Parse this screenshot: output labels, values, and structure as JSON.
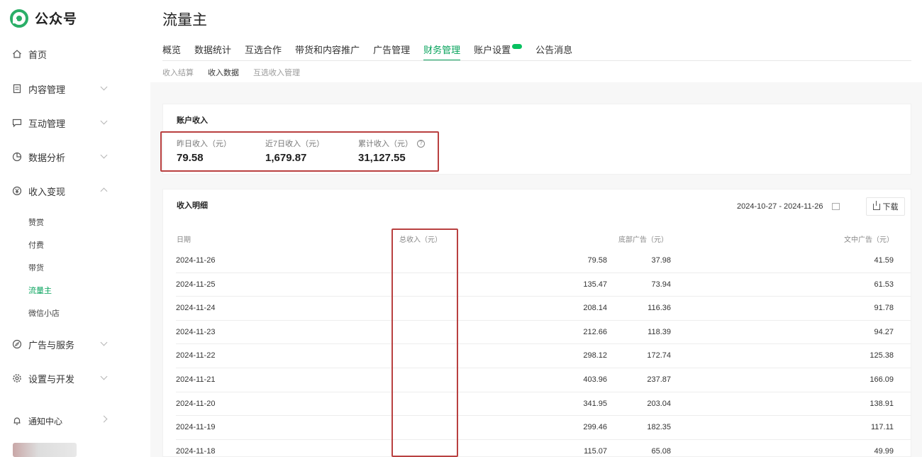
{
  "app": {
    "name": "公众号"
  },
  "sidebar": {
    "items": [
      {
        "label": "首页"
      },
      {
        "label": "内容管理"
      },
      {
        "label": "互动管理"
      },
      {
        "label": "数据分析"
      },
      {
        "label": "收入变现"
      },
      {
        "label": "广告与服务"
      },
      {
        "label": "设置与开发"
      },
      {
        "label": "通知中心"
      }
    ],
    "monetize_sub": [
      {
        "label": "赞赏"
      },
      {
        "label": "付费"
      },
      {
        "label": "带货"
      },
      {
        "label": "流量主"
      },
      {
        "label": "微信小店"
      }
    ]
  },
  "page": {
    "title": "流量主"
  },
  "tabs": [
    {
      "label": "概览"
    },
    {
      "label": "数据统计"
    },
    {
      "label": "互选合作"
    },
    {
      "label": "带货和内容推广"
    },
    {
      "label": "广告管理"
    },
    {
      "label": "财务管理"
    },
    {
      "label": "账户设置"
    },
    {
      "label": "公告消息"
    }
  ],
  "subtabs": [
    {
      "label": "收入结算"
    },
    {
      "label": "收入数据"
    },
    {
      "label": "互选收入管理"
    }
  ],
  "account_income": {
    "title": "账户收入",
    "yesterday": {
      "label": "昨日收入（元）",
      "value": "79.58"
    },
    "last7": {
      "label": "近7日收入（元）",
      "value": "1,679.87"
    },
    "total": {
      "label": "累计收入（元）",
      "value": "31,127.55"
    }
  },
  "income_detail": {
    "title": "收入明细",
    "date_range": "2024-10-27 - 2024-11-26",
    "download_label": "下载",
    "columns": [
      "日期",
      "总收入（元）",
      "底部广告（元）",
      "文中广告（元）"
    ],
    "rows": [
      {
        "date": "2024-11-26",
        "total": "79.58",
        "bottom": "37.98",
        "mid": "41.59"
      },
      {
        "date": "2024-11-25",
        "total": "135.47",
        "bottom": "73.94",
        "mid": "61.53"
      },
      {
        "date": "2024-11-24",
        "total": "208.14",
        "bottom": "116.36",
        "mid": "91.78"
      },
      {
        "date": "2024-11-23",
        "total": "212.66",
        "bottom": "118.39",
        "mid": "94.27"
      },
      {
        "date": "2024-11-22",
        "total": "298.12",
        "bottom": "172.74",
        "mid": "125.38"
      },
      {
        "date": "2024-11-21",
        "total": "403.96",
        "bottom": "237.87",
        "mid": "166.09"
      },
      {
        "date": "2024-11-20",
        "total": "341.95",
        "bottom": "203.04",
        "mid": "138.91"
      },
      {
        "date": "2024-11-19",
        "total": "299.46",
        "bottom": "182.35",
        "mid": "117.11"
      },
      {
        "date": "2024-11-18",
        "total": "115.07",
        "bottom": "65.08",
        "mid": "49.99"
      }
    ]
  },
  "colors": {
    "accent": "#07a35c",
    "highlight_box": "#b94040"
  }
}
